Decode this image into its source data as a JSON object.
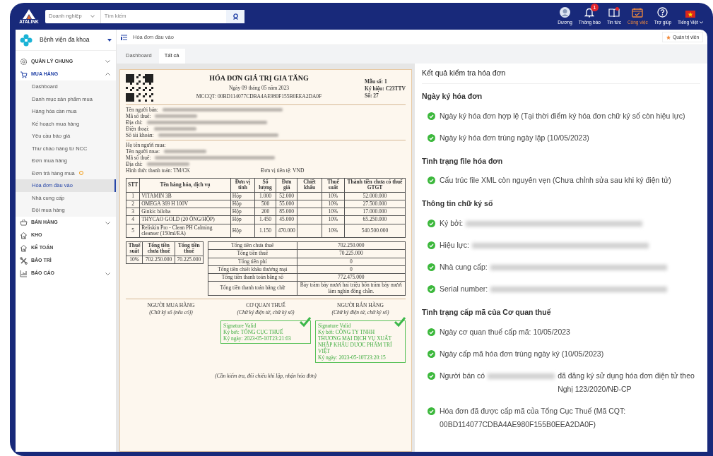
{
  "app": {
    "logo_text": "ATALINK"
  },
  "search": {
    "scope": "Doanh nghiệp",
    "placeholder": "Tìm kiếm"
  },
  "header_items": [
    {
      "label": "Dương",
      "kind": "avatar",
      "selected": false,
      "dot": false
    },
    {
      "label": "Thông báo",
      "kind": "bell",
      "selected": false,
      "dot": false,
      "badge": "1"
    },
    {
      "label": "Tin tức",
      "kind": "book",
      "selected": false,
      "dot": true
    },
    {
      "label": "Công việc",
      "kind": "calendar",
      "selected": true,
      "dot": false
    },
    {
      "label": "Trợ giúp",
      "kind": "help",
      "selected": false,
      "dot": false
    },
    {
      "label": "Tiếng Việt",
      "kind": "flag",
      "selected": false,
      "dot": false
    }
  ],
  "sidebar": {
    "org": "Bệnh viện đa khoa",
    "sections": [
      {
        "label": "QUẢN LÝ CHUNG",
        "kind": "gear",
        "expandable": true,
        "expanded": false,
        "selected": false
      },
      {
        "label": "MUA HÀNG",
        "kind": "cart",
        "expandable": true,
        "expanded": true,
        "selected": true,
        "children": [
          {
            "label": "Dashboard",
            "selected": false,
            "alert": false
          },
          {
            "label": "Danh mục sản phẩm mua",
            "selected": false,
            "alert": false
          },
          {
            "label": "Hàng hóa cần mua",
            "selected": false,
            "alert": false
          },
          {
            "label": "Kế hoạch mua hàng",
            "selected": false,
            "alert": false
          },
          {
            "label": "Yêu cầu báo giá",
            "selected": false,
            "alert": false
          },
          {
            "label": "Thư chào hàng từ NCC",
            "selected": false,
            "alert": false
          },
          {
            "label": "Đơn mua hàng",
            "selected": false,
            "alert": false
          },
          {
            "label": "Đơn trả hàng mua",
            "selected": false,
            "alert": true
          },
          {
            "label": "Hóa đơn đầu vào",
            "selected": true,
            "alert": false
          },
          {
            "label": "Nhà cung cấp",
            "selected": false,
            "alert": false
          },
          {
            "label": "Đội mua hàng",
            "selected": false,
            "alert": false
          }
        ]
      },
      {
        "label": "BÁN HÀNG",
        "kind": "basket",
        "expandable": true,
        "expanded": false,
        "selected": false
      },
      {
        "label": "KHO",
        "kind": "house",
        "expandable": false,
        "expanded": false,
        "selected": false
      },
      {
        "label": "KẾ TOÁN",
        "kind": "house",
        "expandable": false,
        "expanded": false,
        "selected": false
      },
      {
        "label": "BẢO TRÌ",
        "kind": "tools",
        "expandable": false,
        "expanded": false,
        "selected": false
      },
      {
        "label": "BÁO CÁO",
        "kind": "chart",
        "expandable": true,
        "expanded": false,
        "selected": false
      }
    ]
  },
  "breadcrumb": {
    "title": "Hóa đơn đầu vào",
    "role": "Quản trị viên"
  },
  "tabs": [
    {
      "label": "Dashboard",
      "selected": false
    },
    {
      "label": "Tất cả",
      "selected": true
    }
  ],
  "invoice": {
    "title": "HÓA ĐƠN GIÁ TRỊ GIA TĂNG",
    "date": "Ngày 09 tháng 05 năm 2023",
    "mccqt": "MCCQT: 00BD114077CDBA4AE980F155B0EEA2DA0F",
    "meta": [
      "Mẫu số: 1",
      "Ký hiệu: C23TTV",
      "Số: 27"
    ],
    "seller": [
      {
        "label": "Tên người bán:",
        "redacted": true
      },
      {
        "label": "Mã số thuế:",
        "redacted": true
      },
      {
        "label": "Địa chỉ:",
        "redacted": true
      },
      {
        "label": "Điện thoại:",
        "redacted": true
      },
      {
        "label": "Số tài khoản:",
        "redacted": true
      }
    ],
    "buyer": [
      {
        "label": "Họ tên người mua:",
        "redacted": false
      },
      {
        "label": "Tên người mua:",
        "redacted": true
      },
      {
        "label": "Mã số thuế:",
        "redacted": true
      },
      {
        "label": "Địa chỉ:",
        "redacted": true
      }
    ],
    "payment": {
      "label": "Hình thức thanh toán:",
      "value": "TM/CK"
    },
    "currency": {
      "label": "Đơn vị tiền tệ:",
      "value": "VND"
    },
    "items_table": {
      "columns": [
        "STT",
        "Tên hàng hóa, dịch vụ",
        "Đơn vị tính",
        "Số lượng",
        "Đơn giá",
        "Chiết khấu",
        "Thuế suất",
        "Thành tiền chưa có thuế GTGT"
      ],
      "rows": [
        [
          "1",
          "VITAMIN 3B",
          "Hộp",
          "1.000",
          "52.000",
          "",
          "10%",
          "52.000.000"
        ],
        [
          "2",
          "OMEGA 369 H 100V",
          "Hộp",
          "500",
          "55.000",
          "",
          "10%",
          "27.500.000"
        ],
        [
          "3",
          "Ginkic biloba",
          "Hộp",
          "200",
          "85.000",
          "",
          "10%",
          "17.000.000"
        ],
        [
          "4",
          "THYCAO GOLD (20 ỐNG/HỘP)",
          "Hộp",
          "1.450",
          "45.000",
          "",
          "10%",
          "65.250.000"
        ],
        [
          "5",
          "Reliskin Pro - Clean PH Calming cleanser (150ml/EA)",
          "Hộp",
          "1.150",
          "470.000",
          "",
          "10%",
          "540.500.000"
        ]
      ]
    },
    "tax_table": {
      "columns": [
        "Thuế suất",
        "Tổng tiền chưa thuế",
        "Tổng tiền thuế"
      ],
      "rows": [
        [
          "10%",
          "702.250.000",
          "70.225.000"
        ]
      ]
    },
    "totals": [
      {
        "label": "Tổng tiền chưa thuế",
        "value": "702.250.000"
      },
      {
        "label": "Tổng tiền thuế",
        "value": "70.225.000"
      },
      {
        "label": "Tổng tiền phí",
        "value": "0"
      },
      {
        "label": "Tổng tiền chiết khấu thương mại",
        "value": "0"
      },
      {
        "label": "Tổng tiền thanh toán bằng số",
        "value": "772.475.000"
      },
      {
        "label": "Tổng tiền thanh toán bằng chữ",
        "value": "Bảy trăm bảy mươi hai triệu bốn trăm bảy mươi lăm nghìn đồng chẵn."
      }
    ],
    "signers": [
      {
        "title": "NGƯỜI MUA HÀNG",
        "note": "(Chữ ký số (nếu có))"
      },
      {
        "title": "CƠ QUAN THUẾ",
        "note": "(Chữ ký điện tử, chữ ký số)",
        "stamp": [
          "Signature Valid",
          "Ký bởi: TỔNG CỤC THUẾ",
          "Ký ngày: 2023-05-10T23:21:03"
        ]
      },
      {
        "title": "NGƯỜI BÁN HÀNG",
        "note": "(Chữ ký điện tử, chữ ký số)",
        "stamp": [
          "Signature Valid",
          "Ký bởi: CÔNG TY TNHH THƯƠNG MẠI DỊCH VỤ XUẤT NHẬP KHẨU DƯỢC PHẨM TRÍ VIỆT",
          "Ký ngày: 2023-05-10T23:20:15"
        ]
      }
    ],
    "footer": "(Cần kiểm tra, đối chiếu khi lập, nhận hóa đơn)"
  },
  "results": {
    "title": "Kết quả kiểm tra hóa đơn",
    "groups": [
      {
        "title": "Ngày ký hóa đơn",
        "items": [
          {
            "valid": true,
            "text": "Ngày ký hóa đơn hợp lệ (Tại thời điểm ký hóa đơn chữ ký số còn hiệu lực)",
            "redacted": false
          },
          {
            "valid": true,
            "text": "Ngày ký hóa đơn trùng ngày lập (10/05/2023)",
            "redacted": false
          }
        ]
      },
      {
        "title": "Tình trạng file hóa đơn",
        "items": [
          {
            "valid": true,
            "text": "Cấu trúc file XML còn nguyên vẹn (Chưa chỉnh sửa sau khi ký điện tử)",
            "redacted": false
          }
        ]
      },
      {
        "title": "Thông tin chữ ký số",
        "items": [
          {
            "valid": true,
            "text": "Ký bởi:",
            "redacted": true
          },
          {
            "valid": true,
            "text": "Hiệu lực:",
            "redacted": true
          },
          {
            "valid": true,
            "text": "Nhà cung cấp:",
            "redacted": true
          },
          {
            "valid": true,
            "text": "Serial number:",
            "redacted": true
          }
        ]
      },
      {
        "title": "Tình trạng cấp mã của Cơ quan thuế",
        "items": [
          {
            "valid": true,
            "text": "Ngày cơ quan thuế cấp mã: 10/05/2023",
            "redacted": false
          },
          {
            "valid": true,
            "text": "Ngày cấp mã hóa đơn trùng ngày ký (10/05/2023)",
            "redacted": false
          },
          {
            "valid": true,
            "text": "Người bán có",
            "redacted": true,
            "text_after": "đã đăng ký sử dụng hóa đơn điện tử theo Nghị 123/2020/NĐ-CP"
          },
          {
            "valid": true,
            "text": "Hóa đơn đã được cấp mã của Tổng Cục Thuế (Mã CQT: 00BD114077CDBA4AE980F155B0EEA2DA0F)",
            "redacted": false
          }
        ]
      }
    ]
  }
}
